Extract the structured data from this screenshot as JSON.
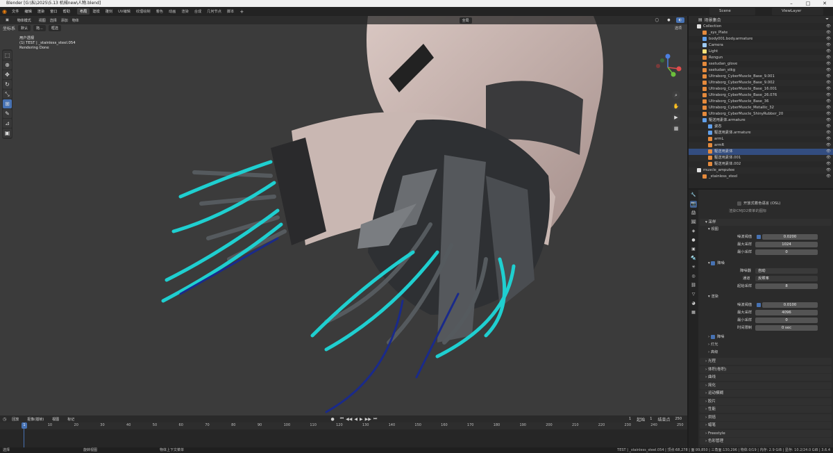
{
  "window": {
    "title": "Blender [G:\\私\\2025\\5.13 机械new\\人物.blend]"
  },
  "menu": [
    "文件",
    "编辑",
    "渲染",
    "窗口",
    "帮助"
  ],
  "workspaces": [
    "布局",
    "建模",
    "雕刻",
    "UV编辑",
    "纹理绘制",
    "着色",
    "动画",
    "渲染",
    "合成",
    "几何节点",
    "脚本"
  ],
  "active_workspace": "布局",
  "scene": {
    "label": "Scene"
  },
  "view_layer": {
    "label": "ViewLayer"
  },
  "viewport": {
    "mode": "物体模式",
    "view_menu": [
      "视图",
      "选择",
      "添加",
      "物体"
    ],
    "orientation_label": "坐标系",
    "orientation": "默认",
    "drag": "拖...",
    "pivot": "框选",
    "global": "全局",
    "overlay_label": "选项",
    "hud_line1": "用户透视",
    "hud_line2": "(1) TEST | _stainless_steel.054",
    "hud_line3": "Rendering Done"
  },
  "timeline": {
    "menu": [
      "回放",
      "抠像(插帧)",
      "视图",
      "标记"
    ],
    "current_frame": "1",
    "start_label": "起始",
    "start": "1",
    "end_label": "结束点",
    "end": "250",
    "ticks": [
      "0",
      "10",
      "20",
      "30",
      "40",
      "50",
      "60",
      "70",
      "80",
      "90",
      "100",
      "110",
      "120",
      "130",
      "140",
      "150",
      "160",
      "170",
      "180",
      "190",
      "200",
      "210",
      "220",
      "230",
      "240",
      "250"
    ],
    "playhead": "1"
  },
  "status": {
    "left": "选择",
    "mid1": "旋转视图",
    "mid2": "物体上下文菜单",
    "right": "TEST | _stainless_steel.054 | 顶点:68,278 | 面:99,850 | 三角面:130,296 | 物体:0/19 | 内存: 2.9 GiB | 显存: 10.2/24.0 GiB | 3.6.4"
  },
  "outliner": {
    "header": "场景集合",
    "rows": [
      {
        "name": "Collection",
        "indent": 1,
        "color": "#e0e0e0"
      },
      {
        "name": "_sys_Plate",
        "indent": 2,
        "color": "#e58a3c"
      },
      {
        "name": "body001.body.armature",
        "indent": 2,
        "color": "#62a0ea"
      },
      {
        "name": "Camera",
        "indent": 2,
        "color": "#9ecbf5"
      },
      {
        "name": "Light",
        "indent": 2,
        "color": "#f5e07a"
      },
      {
        "name": "Rengun",
        "indent": 2,
        "color": "#e58a3c"
      },
      {
        "name": "ssetudan_glove",
        "indent": 2,
        "color": "#e58a3c"
      },
      {
        "name": "ssetudan_stkg",
        "indent": 2,
        "color": "#e58a3c"
      },
      {
        "name": "Ultraborg_CyberMuscle_Base_9.001",
        "indent": 2,
        "color": "#e58a3c"
      },
      {
        "name": "Ultraborg_CyberMuscle_Base_9.002",
        "indent": 2,
        "color": "#e58a3c"
      },
      {
        "name": "Ultraborg_CyberMuscle_Base_16.001",
        "indent": 2,
        "color": "#e58a3c"
      },
      {
        "name": "Ultraborg_CyberMuscle_Base_26.076",
        "indent": 2,
        "color": "#e58a3c"
      },
      {
        "name": "Ultraborg_CyberMuscle_Base_36",
        "indent": 2,
        "color": "#e58a3c"
      },
      {
        "name": "Ultraborg_CyberMuscle_Metallic_32",
        "indent": 2,
        "color": "#e58a3c"
      },
      {
        "name": "Ultraborg_CyberMuscle_ShinyRubber_20",
        "indent": 2,
        "color": "#e58a3c"
      },
      {
        "name": "駆送用素体.armature",
        "indent": 2,
        "color": "#62a0ea"
      },
      {
        "name": "姿态",
        "indent": 3,
        "color": "#62a0ea"
      },
      {
        "name": "駆送用素体.armature",
        "indent": 3,
        "color": "#62a0ea"
      },
      {
        "name": "armL",
        "indent": 3,
        "color": "#e58a3c"
      },
      {
        "name": "armR",
        "indent": 3,
        "color": "#e58a3c"
      },
      {
        "name": "駆送用素体",
        "indent": 3,
        "color": "#e58a3c"
      },
      {
        "name": "駆送用素体.001",
        "indent": 3,
        "color": "#e58a3c"
      },
      {
        "name": "駆送用素体.002",
        "indent": 3,
        "color": "#e58a3c"
      },
      {
        "name": "muscle_amputee",
        "indent": 1,
        "color": "#e0e0e0"
      },
      {
        "name": "_stainless_steel",
        "indent": 2,
        "color": "#e58a3c"
      }
    ]
  },
  "properties": {
    "osl": "开放式着色语言 (OSL)",
    "device_hint": "渲染CMJD2菜单的图标",
    "sampling": "采样",
    "viewport": "视图",
    "noise_threshold_label": "噪波阈值",
    "noise_threshold": "0.0200",
    "max_samples_label": "最大采样",
    "max_samples": "1024",
    "min_samples_label": "最小采样",
    "min_samples": "0",
    "denoise": "降噪",
    "denoiser_label": "降噪器",
    "denoiser": "自动",
    "passes_label": "通道",
    "passes": "反照率",
    "start_sample_label": "起始采样",
    "start_sample": "8",
    "render": "渲染",
    "r_noise_threshold_label": "噪波阈值",
    "r_noise_threshold": "0.0100",
    "r_max_samples_label": "最大采样",
    "r_max_samples": "4096",
    "r_min_samples_label": "最小采样",
    "r_min_samples": "0",
    "time_limit_label": "时间限制",
    "time_limit": "0 sec",
    "r_denoise": "降噪",
    "lights": "灯光",
    "advanced": "高级",
    "sections": [
      "光程",
      "体积(卷积)",
      "曲线",
      "简化",
      "运动模糊",
      "胶片",
      "性能",
      "烘焙",
      "蜡笔",
      "Freestyle",
      "色彩管理"
    ]
  }
}
